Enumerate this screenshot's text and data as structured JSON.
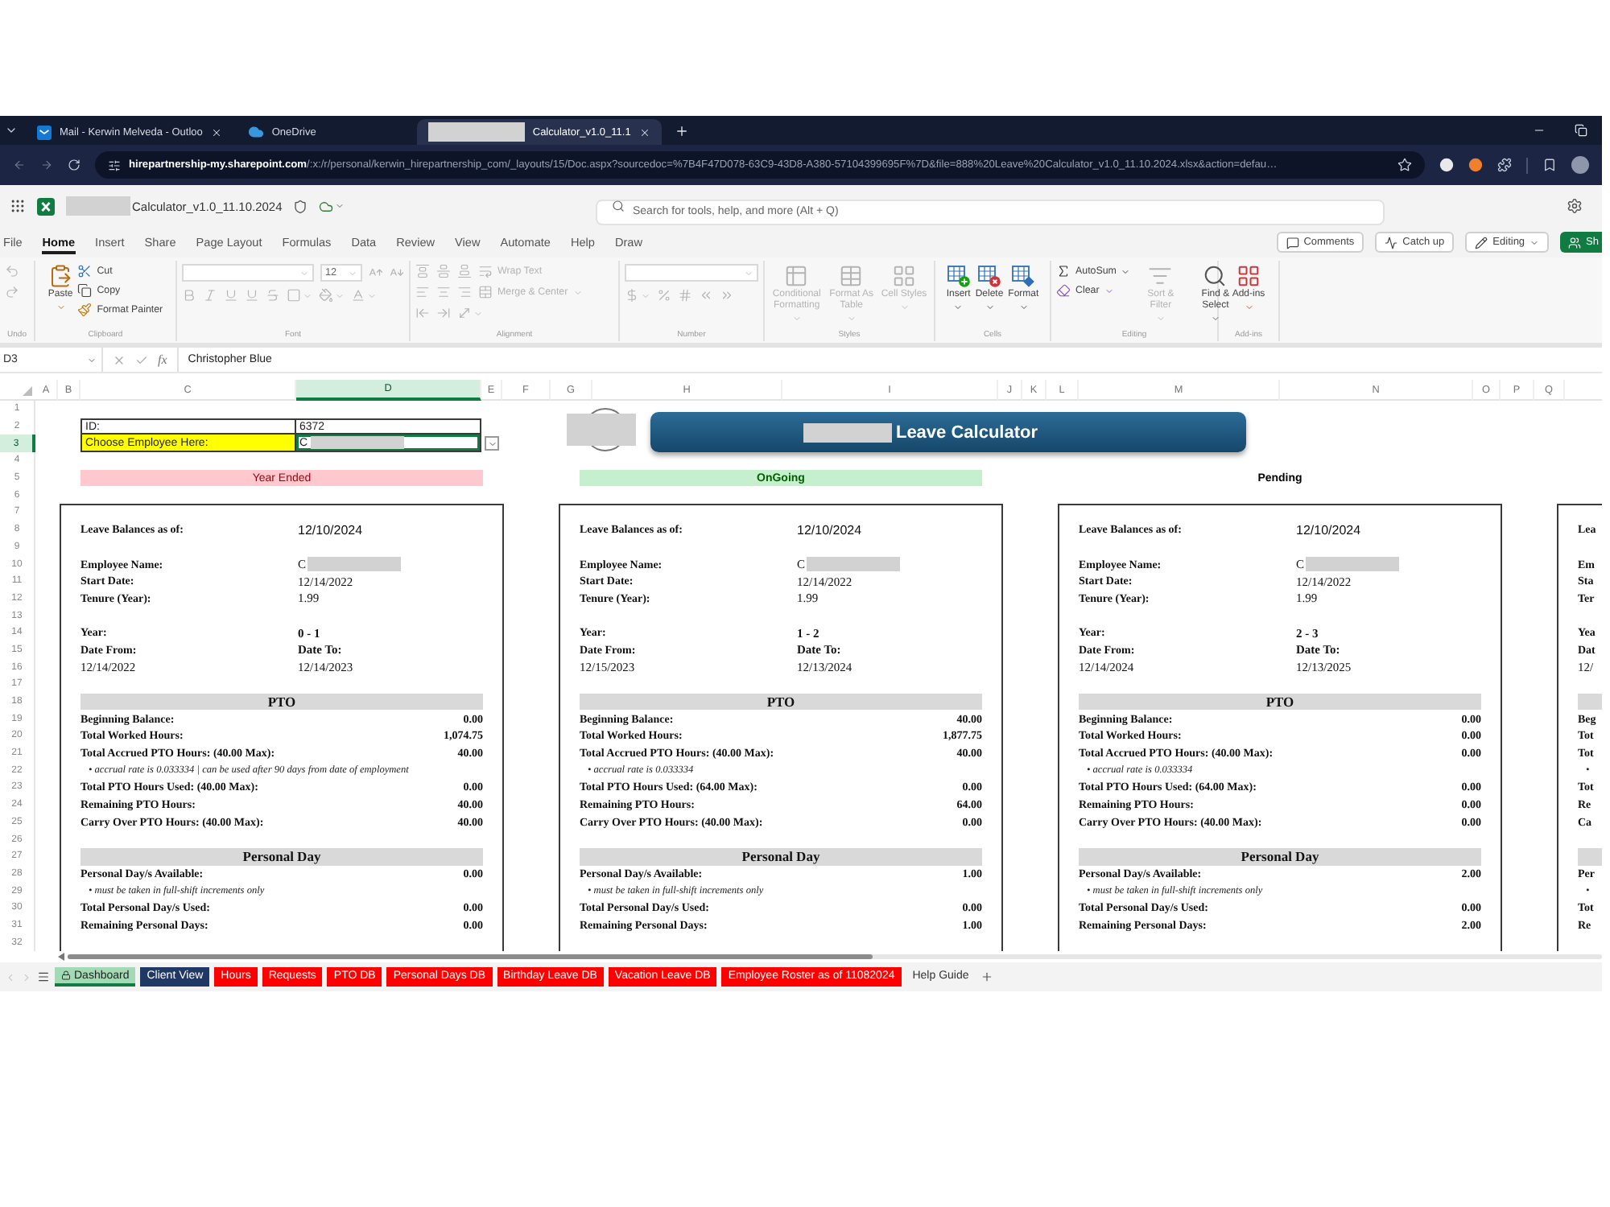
{
  "browser": {
    "tabs": [
      {
        "title": "Mail - Kerwin Melveda - Outloo",
        "kind": "mail",
        "selected": false,
        "closable": true
      },
      {
        "title": "OneDrive",
        "kind": "cloud",
        "selected": false,
        "closable": false
      },
      {
        "title": "Calculator_v1.0_11.1",
        "kind": "redacted",
        "selected": true,
        "closable": true
      }
    ],
    "url": "**hirepartnership-my.sharepoint.com**/:x:/r/personal/kerwin_hirepartnership_com/_layouts/15/Doc.aspx?sourcedoc=%7B4F47D078-63C9-43D8-A380-57104399695F%7D&file=888%20Leave%20Calculator_v1.0_11.10.2024.xlsx&action=defau…"
  },
  "app": {
    "file_name": "Calculator_v1.0_11.10.2024",
    "search": {
      "placeholder": "Search for tools, help, and more (Alt + Q)"
    }
  },
  "ribbon_tabs": [
    {
      "label": "File",
      "selected": false
    },
    {
      "label": "Home",
      "selected": true
    },
    {
      "label": "Insert",
      "selected": false
    },
    {
      "label": "Share",
      "selected": false
    },
    {
      "label": "Page Layout",
      "selected": false
    },
    {
      "label": "Formulas",
      "selected": false
    },
    {
      "label": "Data",
      "selected": false
    },
    {
      "label": "Review",
      "selected": false
    },
    {
      "label": "View",
      "selected": false
    },
    {
      "label": "Automate",
      "selected": false
    },
    {
      "label": "Help",
      "selected": false
    },
    {
      "label": "Draw",
      "selected": false
    }
  ],
  "ribbon_actions": [
    {
      "label": "Comments",
      "kind": "comments",
      "dropdown": false
    },
    {
      "label": "Catch up",
      "kind": "catchup",
      "dropdown": false
    },
    {
      "label": "Editing",
      "kind": "editing",
      "dropdown": true
    },
    {
      "label": "Sh",
      "kind": "share",
      "dropdown": false
    }
  ],
  "ribbon": {
    "groups": [
      {
        "label": "Undo",
        "kind": "rows",
        "items": [
          [
            {
              "kind": "icon",
              "dropdown": false,
              "disabled": true
            }
          ],
          [
            {
              "kind": "icon",
              "dropdown": false,
              "disabled": true
            }
          ]
        ]
      },
      {
        "label": "Clipboard",
        "kind": "columns",
        "items": [
          [
            {
              "kind": "large",
              "label": "Paste",
              "dropdown": true,
              "disabled": false
            }
          ],
          [
            {
              "kind": "small",
              "label": "Cut",
              "dropdown": false,
              "disabled": false
            },
            {
              "kind": "small",
              "label": "Copy",
              "dropdown": false,
              "disabled": false
            },
            {
              "kind": "small",
              "label": "Format Painter",
              "dropdown": false,
              "disabled": false
            }
          ]
        ]
      },
      {
        "label": "Font",
        "kind": "rows",
        "items": [
          [
            {
              "kind": "field",
              "dropdown": true,
              "disabled": true
            },
            {
              "kind": "field",
              "value": "12",
              "dropdown": true,
              "disabled": true
            },
            {
              "kind": "icon",
              "dropdown": false,
              "disabled": true
            },
            {
              "kind": "icon",
              "dropdown": false,
              "disabled": true
            }
          ],
          [
            {
              "kind": "icon",
              "dropdown": false,
              "disabled": true
            },
            {
              "kind": "icon",
              "dropdown": false,
              "disabled": true
            },
            {
              "kind": "icon",
              "dropdown": false,
              "disabled": true
            },
            {
              "kind": "icon",
              "dropdown": false,
              "disabled": true
            },
            {
              "kind": "icon",
              "dropdown": false,
              "disabled": true
            },
            {
              "kind": "icon",
              "dropdown": true,
              "disabled": true
            },
            {
              "kind": "icon",
              "dropdown": true,
              "disabled": true
            },
            {
              "kind": "icon",
              "dropdown": true,
              "disabled": true
            }
          ]
        ]
      },
      {
        "label": "Alignment",
        "kind": "rows",
        "items": [
          [
            {
              "kind": "icon",
              "dropdown": false,
              "disabled": true
            },
            {
              "kind": "icon",
              "dropdown": false,
              "disabled": true
            },
            {
              "kind": "icon",
              "dropdown": false,
              "disabled": true
            },
            {
              "kind": "small",
              "label": "Wrap Text",
              "dropdown": false,
              "disabled": true
            }
          ],
          [
            {
              "kind": "icon",
              "dropdown": false,
              "disabled": true
            },
            {
              "kind": "icon",
              "dropdown": false,
              "disabled": true
            },
            {
              "kind": "icon",
              "dropdown": false,
              "disabled": true
            },
            {
              "kind": "small",
              "label": "Merge & Center",
              "dropdown": true,
              "disabled": true
            }
          ],
          [
            {
              "kind": "icon",
              "dropdown": false,
              "disabled": true
            },
            {
              "kind": "icon",
              "dropdown": false,
              "disabled": true
            },
            {
              "kind": "icon",
              "dropdown": true,
              "disabled": true
            }
          ]
        ]
      },
      {
        "label": "Number",
        "kind": "rows",
        "items": [
          [
            {
              "kind": "field",
              "dropdown": true,
              "disabled": true
            }
          ],
          [
            {
              "kind": "icon",
              "dropdown": true,
              "disabled": true
            },
            {
              "kind": "icon",
              "dropdown": false,
              "disabled": true
            },
            {
              "kind": "icon",
              "dropdown": false,
              "disabled": true
            },
            {
              "kind": "icon",
              "dropdown": false,
              "disabled": true
            },
            {
              "kind": "icon",
              "dropdown": false,
              "disabled": true
            }
          ]
        ]
      },
      {
        "label": "Styles",
        "kind": "columns",
        "items": [
          [
            {
              "kind": "large",
              "label": "Conditional Formatting",
              "dropdown": true,
              "disabled": true
            }
          ],
          [
            {
              "kind": "large",
              "label": "Format As Table",
              "dropdown": true,
              "disabled": true
            }
          ],
          [
            {
              "kind": "large",
              "label": "Cell Styles",
              "dropdown": true,
              "disabled": true
            }
          ]
        ]
      },
      {
        "label": "Cells",
        "kind": "columns",
        "items": [
          [
            {
              "kind": "large",
              "label": "Insert",
              "dropdown": true,
              "disabled": false
            }
          ],
          [
            {
              "kind": "large",
              "label": "Delete",
              "dropdown": true,
              "disabled": false
            }
          ],
          [
            {
              "kind": "large",
              "label": "Format",
              "dropdown": true,
              "disabled": false
            }
          ]
        ]
      },
      {
        "label": "Editing",
        "kind": "columns",
        "items": [
          [
            {
              "kind": "small",
              "label": "AutoSum",
              "dropdown": true,
              "disabled": false
            },
            {
              "kind": "small",
              "label": "Clear",
              "dropdown": true,
              "disabled": false
            }
          ],
          [
            {
              "kind": "large",
              "label": "Sort & Filter",
              "dropdown": true,
              "disabled": true
            }
          ],
          [
            {
              "kind": "large",
              "label": "Find & Select",
              "dropdown": true,
              "disabled": false
            }
          ]
        ]
      },
      {
        "label": "Add-ins",
        "kind": "columns",
        "items": [
          [
            {
              "kind": "large",
              "label": "Add-ins",
              "dropdown": true,
              "disabled": false
            }
          ]
        ]
      }
    ]
  },
  "formula_bar": {
    "name_box": "D3",
    "function_label": "fx",
    "value": "Christopher Blue"
  },
  "sheet": {
    "columns": [
      {
        "label": "A",
        "selected": false
      },
      {
        "label": "B",
        "selected": false
      },
      {
        "label": "C",
        "selected": false
      },
      {
        "label": "D",
        "selected": true
      },
      {
        "label": "E",
        "selected": false
      },
      {
        "label": "F",
        "selected": false
      },
      {
        "label": "G",
        "selected": false
      },
      {
        "label": "H",
        "selected": false
      },
      {
        "label": "I",
        "selected": false
      },
      {
        "label": "J",
        "selected": false
      },
      {
        "label": "K",
        "selected": false
      },
      {
        "label": "L",
        "selected": false
      },
      {
        "label": "M",
        "selected": false
      },
      {
        "label": "N",
        "selected": false
      },
      {
        "label": "O",
        "selected": false
      },
      {
        "label": "P",
        "selected": false
      },
      {
        "label": "Q",
        "selected": false
      }
    ],
    "rows": [
      {
        "label": "1",
        "selected": false
      },
      {
        "label": "2",
        "selected": false
      },
      {
        "label": "3",
        "selected": true
      },
      {
        "label": "4",
        "selected": false
      },
      {
        "label": "5",
        "selected": false
      },
      {
        "label": "6",
        "selected": false
      },
      {
        "label": "7",
        "selected": false
      },
      {
        "label": "8",
        "selected": false
      },
      {
        "label": "9",
        "selected": false
      },
      {
        "label": "10",
        "selected": false
      },
      {
        "label": "11",
        "selected": false
      },
      {
        "label": "12",
        "selected": false
      },
      {
        "label": "13",
        "selected": false
      },
      {
        "label": "14",
        "selected": false
      },
      {
        "label": "15",
        "selected": false
      },
      {
        "label": "16",
        "selected": false
      },
      {
        "label": "17",
        "selected": false
      },
      {
        "label": "18",
        "selected": false
      },
      {
        "label": "19",
        "selected": false
      },
      {
        "label": "20",
        "selected": false
      },
      {
        "label": "21",
        "selected": false
      },
      {
        "label": "22",
        "selected": false
      },
      {
        "label": "23",
        "selected": false
      },
      {
        "label": "24",
        "selected": false
      },
      {
        "label": "25",
        "selected": false
      },
      {
        "label": "26",
        "selected": false
      },
      {
        "label": "27",
        "selected": false
      },
      {
        "label": "28",
        "selected": false
      },
      {
        "label": "29",
        "selected": false
      },
      {
        "label": "30",
        "selected": false
      },
      {
        "label": "31",
        "selected": false
      },
      {
        "label": "32",
        "selected": false
      }
    ],
    "top_cells": [
      {
        "label": "ID:",
        "value": "6372",
        "highlighted": false,
        "selected": false,
        "redacted": false,
        "kind": "plain"
      },
      {
        "label": "Choose Employee Here:",
        "value": "C",
        "highlighted": true,
        "selected": true,
        "redacted": true,
        "kind": "dropdown"
      }
    ],
    "banner_title": "Leave Calculator",
    "panels": [
      {
        "status": {
          "label": "Year Ended",
          "kind": "ended"
        },
        "balance": {
          "label": "Leave Balances as of:",
          "value": "12/10/2024"
        },
        "fields": [
          {
            "label": "Employee Name:",
            "value": "C",
            "redacted": true
          },
          {
            "label": "Start Date:",
            "value": "12/14/2022",
            "redacted": false
          },
          {
            "label": "Tenure (Year):",
            "value": "1.99",
            "redacted": false
          }
        ],
        "year": {
          "label": "Year:",
          "value": "0 - 1"
        },
        "dates": {
          "from_label": "Date From:",
          "to_label": "Date To:",
          "from": "12/14/2022",
          "to": "12/14/2023"
        },
        "sections": [
          {
            "title": "PTO",
            "rows": [
              {
                "kind": "line",
                "label": "Beginning Balance:",
                "value": "0.00"
              },
              {
                "kind": "line",
                "label": "Total Worked Hours:",
                "value": "1,074.75"
              },
              {
                "kind": "line",
                "label": "Total Accrued PTO Hours: (40.00 Max):",
                "value": "40.00"
              },
              {
                "kind": "note",
                "text": "• accrual rate is 0.033334 | can be used after 90 days from date of employment"
              },
              {
                "kind": "line",
                "label": "Total PTO Hours Used: (40.00 Max):",
                "value": "0.00"
              },
              {
                "kind": "line",
                "label": "Remaining PTO Hours:",
                "value": "40.00"
              },
              {
                "kind": "line",
                "label": "Carry Over PTO Hours: (40.00 Max):",
                "value": "40.00"
              }
            ]
          },
          {
            "title": "Personal Day",
            "rows": [
              {
                "kind": "line",
                "label": "Personal Day/s Available:",
                "value": "0.00"
              },
              {
                "kind": "note",
                "text": "• must be taken in full-shift increments only"
              },
              {
                "kind": "line",
                "label": "Total Personal Day/s Used:",
                "value": "0.00"
              },
              {
                "kind": "line",
                "label": "Remaining Personal Days:",
                "value": "0.00"
              }
            ]
          }
        ]
      },
      {
        "status": {
          "label": "OnGoing",
          "kind": "ongoing"
        },
        "balance": {
          "label": "Leave Balances as of:",
          "value": "12/10/2024"
        },
        "fields": [
          {
            "label": "Employee Name:",
            "value": "C",
            "redacted": true
          },
          {
            "label": "Start Date:",
            "value": "12/14/2022",
            "redacted": false
          },
          {
            "label": "Tenure (Year):",
            "value": "1.99",
            "redacted": false
          }
        ],
        "year": {
          "label": "Year:",
          "value": "1 - 2"
        },
        "dates": {
          "from_label": "Date From:",
          "to_label": "Date To:",
          "from": "12/15/2023",
          "to": "12/13/2024"
        },
        "sections": [
          {
            "title": "PTO",
            "rows": [
              {
                "kind": "line",
                "label": "Beginning Balance:",
                "value": "40.00"
              },
              {
                "kind": "line",
                "label": "Total Worked Hours:",
                "value": "1,877.75"
              },
              {
                "kind": "line",
                "label": "Total Accrued PTO Hours: (40.00 Max):",
                "value": "40.00"
              },
              {
                "kind": "note",
                "text": "• accrual rate is 0.033334"
              },
              {
                "kind": "line",
                "label": "Total PTO Hours Used: (64.00 Max):",
                "value": "0.00"
              },
              {
                "kind": "line",
                "label": "Remaining PTO Hours:",
                "value": "64.00"
              },
              {
                "kind": "line",
                "label": "Carry Over PTO Hours: (40.00 Max):",
                "value": "0.00"
              }
            ]
          },
          {
            "title": "Personal Day",
            "rows": [
              {
                "kind": "line",
                "label": "Personal Day/s Available:",
                "value": "1.00"
              },
              {
                "kind": "note",
                "text": "• must be taken in full-shift increments only"
              },
              {
                "kind": "line",
                "label": "Total Personal Day/s Used:",
                "value": "0.00"
              },
              {
                "kind": "line",
                "label": "Remaining Personal Days:",
                "value": "1.00"
              }
            ]
          }
        ]
      },
      {
        "status": {
          "label": "Pending",
          "kind": "pending"
        },
        "balance": {
          "label": "Leave Balances as of:",
          "value": "12/10/2024"
        },
        "fields": [
          {
            "label": "Employee Name:",
            "value": "C",
            "redacted": true
          },
          {
            "label": "Start Date:",
            "value": "12/14/2022",
            "redacted": false
          },
          {
            "label": "Tenure (Year):",
            "value": "1.99",
            "redacted": false
          }
        ],
        "year": {
          "label": "Year:",
          "value": "2 - 3"
        },
        "dates": {
          "from_label": "Date From:",
          "to_label": "Date To:",
          "from": "12/14/2024",
          "to": "12/13/2025"
        },
        "sections": [
          {
            "title": "PTO",
            "rows": [
              {
                "kind": "line",
                "label": "Beginning Balance:",
                "value": "0.00"
              },
              {
                "kind": "line",
                "label": "Total Worked Hours:",
                "value": "0.00"
              },
              {
                "kind": "line",
                "label": "Total Accrued PTO Hours: (40.00 Max):",
                "value": "0.00"
              },
              {
                "kind": "note",
                "text": "• accrual rate is 0.033334"
              },
              {
                "kind": "line",
                "label": "Total PTO Hours Used: (64.00 Max):",
                "value": "0.00"
              },
              {
                "kind": "line",
                "label": "Remaining PTO Hours:",
                "value": "0.00"
              },
              {
                "kind": "line",
                "label": "Carry Over PTO Hours: (40.00 Max):",
                "value": "0.00"
              }
            ]
          },
          {
            "title": "Personal Day",
            "rows": [
              {
                "kind": "line",
                "label": "Personal Day/s Available:",
                "value": "2.00"
              },
              {
                "kind": "note",
                "text": "• must be taken in full-shift increments only"
              },
              {
                "kind": "line",
                "label": "Total Personal Day/s Used:",
                "value": "0.00"
              },
              {
                "kind": "line",
                "label": "Remaining Personal Days:",
                "value": "2.00"
              }
            ]
          }
        ]
      },
      {
        "balance": {
          "label": "Lea"
        },
        "fields": [
          {
            "label": "Em",
            "redacted": false
          },
          {
            "label": "Sta",
            "redacted": false
          },
          {
            "label": "Ter",
            "redacted": false
          }
        ],
        "year": {
          "label": "Yea"
        },
        "dates": {
          "from_label": "Dat",
          "from": "12/"
        },
        "sections": [
          {
            "rows": [
              {
                "kind": "line",
                "label": "Beg"
              },
              {
                "kind": "line",
                "label": "Tot"
              },
              {
                "kind": "line",
                "label": "Tot"
              },
              {
                "kind": "note",
                "text": "•"
              },
              {
                "kind": "line",
                "label": "Tot"
              },
              {
                "kind": "line",
                "label": "Re"
              },
              {
                "kind": "line",
                "label": "Ca"
              }
            ]
          },
          {
            "rows": [
              {
                "kind": "line",
                "label": "Per"
              },
              {
                "kind": "note",
                "text": "•"
              },
              {
                "kind": "line",
                "label": "Tot"
              },
              {
                "kind": "line",
                "label": "Re"
              }
            ]
          }
        ]
      }
    ]
  },
  "sheet_tabs": [
    {
      "label": "Dashboard",
      "color": "#a3d9b5",
      "selected": true,
      "locked": true
    },
    {
      "label": "Client View",
      "color": "#1f3864",
      "selected": false,
      "locked": false
    },
    {
      "label": "Hours",
      "color": "#ff0000",
      "selected": false,
      "locked": false
    },
    {
      "label": "Requests",
      "color": "#ff0000",
      "selected": false,
      "locked": false
    },
    {
      "label": "PTO DB",
      "color": "#ff0000",
      "selected": false,
      "locked": false
    },
    {
      "label": "Personal Days DB",
      "color": "#ff0000",
      "selected": false,
      "locked": false
    },
    {
      "label": "Birthday Leave DB",
      "color": "#ff0000",
      "selected": false,
      "locked": false
    },
    {
      "label": "Vacation Leave DB",
      "color": "#ff0000",
      "selected": false,
      "locked": false
    },
    {
      "label": "Employee Roster as of 11082024",
      "color": "#ff0000",
      "selected": false,
      "locked": false
    },
    {
      "label": "Help Guide",
      "selected": false,
      "locked": false
    }
  ]
}
